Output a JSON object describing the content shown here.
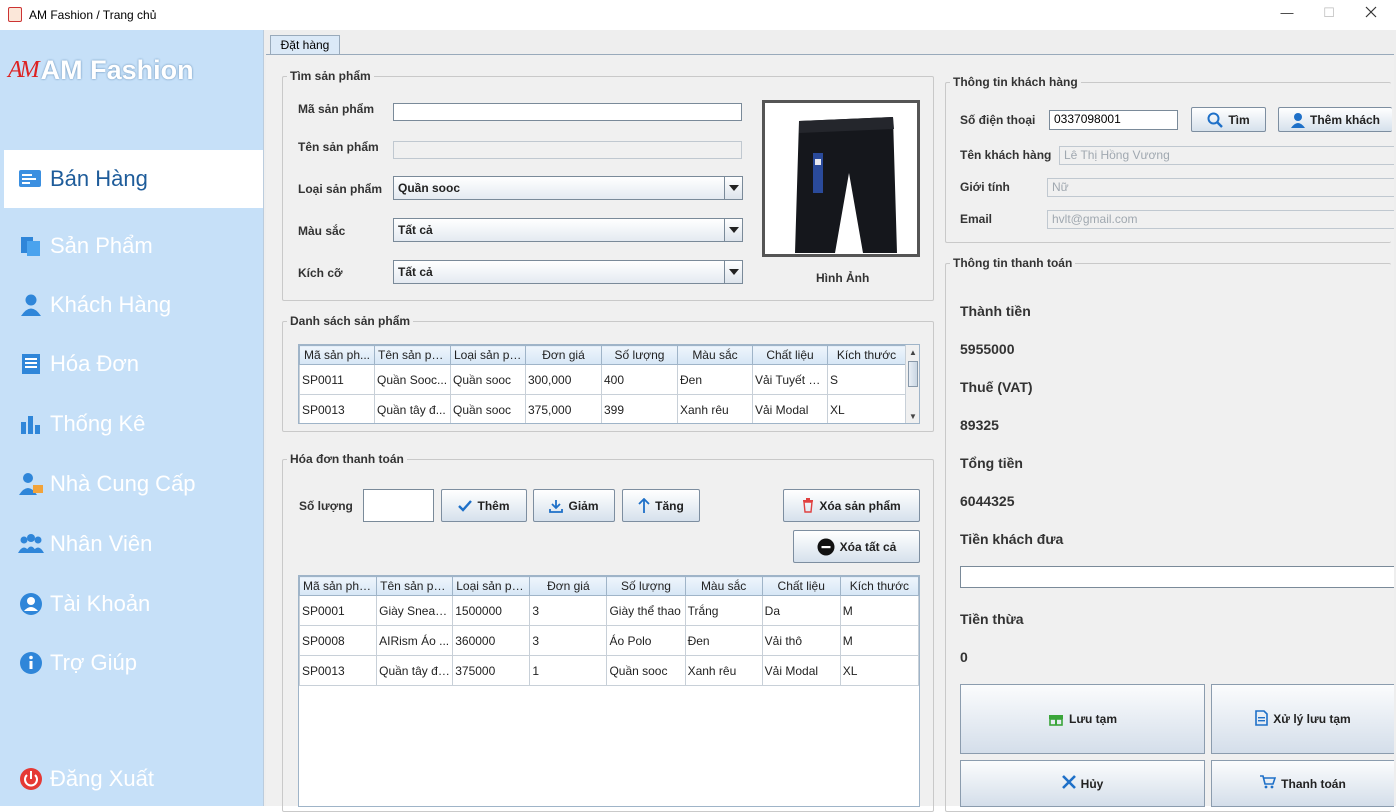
{
  "window": {
    "title": "AM Fashion / Trang chủ",
    "minimize": "—",
    "maximize": "☐"
  },
  "sidebar": {
    "brand_mark": "AM",
    "brand": "AM Fashion",
    "items": [
      {
        "label": "Bán Hàng",
        "icon": "cart-icon"
      },
      {
        "label": "Sản Phẩm",
        "icon": "products-icon"
      },
      {
        "label": "Khách Hàng",
        "icon": "user-icon"
      },
      {
        "label": "Hóa Đơn",
        "icon": "invoice-icon"
      },
      {
        "label": "Thống Kê",
        "icon": "chart-icon"
      },
      {
        "label": "Nhà Cung Cấp",
        "icon": "supplier-icon"
      },
      {
        "label": "Nhân Viên",
        "icon": "staff-icon"
      },
      {
        "label": "Tài Khoản",
        "icon": "account-icon"
      },
      {
        "label": "Trợ Giúp",
        "icon": "info-icon"
      }
    ],
    "logout": "Đăng Xuất"
  },
  "tab": "Đặt hàng",
  "search": {
    "legend": "Tìm sản phẩm",
    "code_label": "Mã sản phẩm",
    "code_value": "",
    "name_label": "Tên sản phẩm",
    "name_value": "",
    "type_label": "Loại sản phẩm",
    "type_value": "Quần sooc",
    "color_label": "Màu sắc",
    "color_value": "Tất cả",
    "size_label": "Kích cỡ",
    "size_value": "Tất cả",
    "image_caption": "Hình Ảnh"
  },
  "product_list": {
    "legend": "Danh sách sản phẩm",
    "columns": [
      "Mã sản ph...",
      "Tên sản ph...",
      "Loại sản ph...",
      "Đơn giá",
      "Số lượng",
      "Màu sắc",
      "Chất liệu",
      "Kích thước"
    ],
    "rows": [
      [
        "SP0011",
        "Quần Sooc...",
        "Quần sooc",
        "300,000",
        "400",
        "Đen",
        "Vải Tuyết M...",
        "S"
      ],
      [
        "SP0013",
        "Quần tây đ...",
        "Quần sooc",
        "375,000",
        "399",
        "Xanh rêu",
        "Vải Modal",
        "XL"
      ]
    ]
  },
  "invoice": {
    "legend": "Hóa đơn thanh toán",
    "qty_label": "Số lượng",
    "qty_value": "",
    "add": "Thêm",
    "decrease": "Giảm",
    "increase": "Tăng",
    "delete_product": "Xóa sản phẩm",
    "delete_all": "Xóa tất cả",
    "columns": [
      "Mã sản phẩ...",
      "Tên sản ph...",
      "Loại sản ph...",
      "Đơn giá",
      "Số lượng",
      "Màu sắc",
      "Chất liệu",
      "Kích thước"
    ],
    "rows": [
      [
        "SP0001",
        "Giày Sneak...",
        "1500000",
        "3",
        "Giày thể thao",
        "Trắng",
        "Da",
        "M"
      ],
      [
        "SP0008",
        "AIRism Áo ...",
        "360000",
        "3",
        "Áo Polo",
        "Đen",
        "Vải thô",
        "M"
      ],
      [
        "SP0013",
        "Quần tây đe...",
        "375000",
        "1",
        "Quần sooc",
        "Xanh rêu",
        "Vải Modal",
        "XL"
      ]
    ]
  },
  "customer": {
    "legend": "Thông tin khách hàng",
    "phone_label": "Số điện thoại",
    "phone_value": "0337098001",
    "find": "Tìm",
    "add_customer": "Thêm khách",
    "name_label": "Tên khách hàng",
    "name_value": "Lê Thị Hồng Vương",
    "gender_label": "Giới tính",
    "gender_value": "Nữ",
    "email_label": "Email",
    "email_value": "hvlt@gmail.com"
  },
  "payment": {
    "legend": "Thông tin thanh toán",
    "subtotal_label": "Thành tiền",
    "subtotal_value": "5955000",
    "vat_label": "Thuế (VAT)",
    "vat_value": "89325",
    "total_label": "Tổng tiền",
    "total_value": "6044325",
    "given_label": "Tiền khách đưa",
    "given_value": "",
    "change_label": "Tiền thừa",
    "change_value": "0",
    "save_draft": "Lưu tạm",
    "process_draft": "Xử lý lưu tạm",
    "cancel": "Hủy",
    "checkout": "Thanh toán"
  },
  "colors": {
    "sidebar": "#c6e0f8",
    "active": "#ffffff",
    "accent": "#1e5c9a",
    "logout_red": "#e53935"
  }
}
